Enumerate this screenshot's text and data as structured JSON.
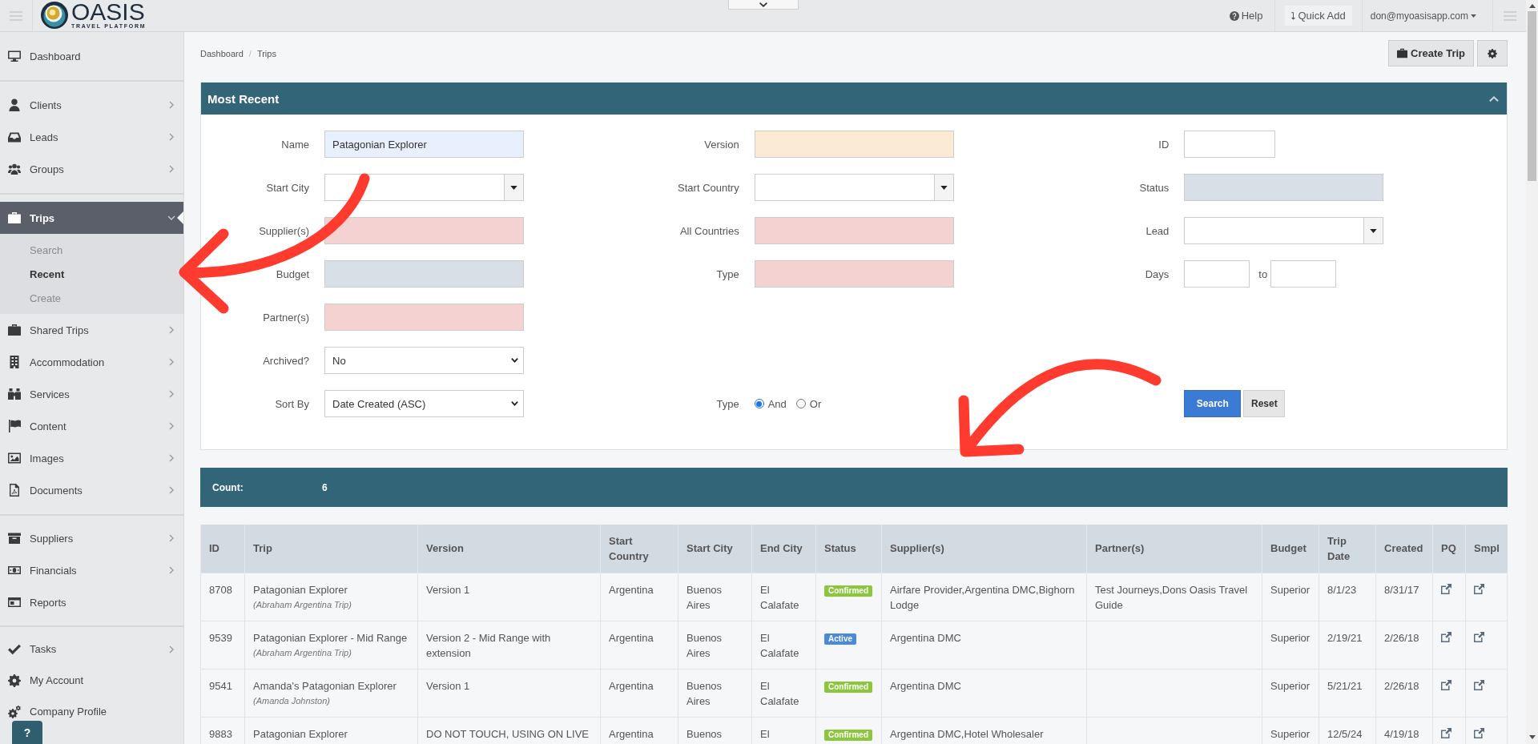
{
  "top_bar": {
    "logo": {
      "name": "OASIS",
      "tagline": "TRAVEL PLATFORM"
    },
    "help": "Help",
    "quick_add": "Quick Add",
    "user": "don@myoasisapp.com"
  },
  "sidebar": {
    "sections": [
      {
        "items": [
          {
            "label": "Dashboard",
            "expandable": false,
            "expanded": false,
            "selected": false
          }
        ]
      },
      {
        "items": [
          {
            "label": "Clients",
            "expandable": true,
            "expanded": false,
            "selected": false
          },
          {
            "label": "Leads",
            "expandable": true,
            "expanded": false,
            "selected": false
          },
          {
            "label": "Groups",
            "expandable": true,
            "expanded": false,
            "selected": false
          }
        ]
      },
      {
        "items": [
          {
            "label": "Trips",
            "expandable": true,
            "expanded": true,
            "selected": true,
            "children": [
              {
                "label": "Search",
                "selected": false
              },
              {
                "label": "Recent",
                "selected": true
              },
              {
                "label": "Create",
                "selected": false
              }
            ]
          },
          {
            "label": "Shared Trips",
            "expandable": true,
            "expanded": false,
            "selected": false
          },
          {
            "label": "Accommodation",
            "expandable": true,
            "expanded": false,
            "selected": false
          },
          {
            "label": "Services",
            "expandable": true,
            "expanded": false,
            "selected": false
          },
          {
            "label": "Content",
            "expandable": true,
            "expanded": false,
            "selected": false
          },
          {
            "label": "Images",
            "expandable": true,
            "expanded": false,
            "selected": false
          },
          {
            "label": "Documents",
            "expandable": true,
            "expanded": false,
            "selected": false
          }
        ]
      },
      {
        "items": [
          {
            "label": "Suppliers",
            "expandable": true,
            "expanded": false,
            "selected": false
          },
          {
            "label": "Financials",
            "expandable": true,
            "expanded": false,
            "selected": false
          },
          {
            "label": "Reports",
            "expandable": false,
            "expanded": false,
            "selected": false
          }
        ]
      },
      {
        "items": [
          {
            "label": "Tasks",
            "expandable": true,
            "expanded": false,
            "selected": false
          },
          {
            "label": "My Account",
            "expandable": false,
            "expanded": false,
            "selected": false
          },
          {
            "label": "Company Profile",
            "expandable": false,
            "expanded": false,
            "selected": false
          }
        ]
      }
    ]
  },
  "help_button": "?",
  "breadcrumb": {
    "items": [
      "Dashboard",
      "Trips"
    ],
    "separator": "/"
  },
  "create_button": "Create Trip",
  "search_panel": {
    "title": "Most Recent",
    "expanded": true,
    "rows": [
      {
        "cells": [
          {
            "kind": "text",
            "label": "Name",
            "value": "Patagonian Explorer",
            "color": "#e8f0fe"
          },
          {
            "kind": "text",
            "label": "Version",
            "color": "#fbebd5"
          },
          {
            "kind": "number",
            "label": "ID",
            "color": "#ffffff"
          }
        ]
      },
      {
        "cells": [
          {
            "kind": "combo",
            "label": "Start City",
            "color": "#ffffff"
          },
          {
            "kind": "combo",
            "label": "Start Country",
            "color": "#ffffff"
          },
          {
            "kind": "text",
            "label": "Status",
            "color": "#d8dfe7"
          }
        ]
      },
      {
        "cells": [
          {
            "kind": "text",
            "label": "Supplier(s)",
            "color": "#f5d2d2"
          },
          {
            "kind": "text",
            "label": "All Countries",
            "color": "#f5d2d2"
          },
          {
            "kind": "combo",
            "label": "Lead",
            "color": "#ffffff"
          }
        ]
      },
      {
        "cells": [
          {
            "kind": "text",
            "label": "Budget",
            "color": "#d8dfe7"
          },
          {
            "kind": "text",
            "label": "Type",
            "color": "#f5d2d2"
          },
          {
            "kind": "range",
            "label": "Days",
            "joiner": "to"
          }
        ]
      },
      {
        "cells": [
          {
            "kind": "text",
            "label": "Partner(s)",
            "color": "#f5d2d2"
          }
        ]
      },
      {
        "cells": [
          {
            "kind": "select",
            "label": "Archived?",
            "value": "No"
          }
        ]
      },
      {
        "cells": [
          {
            "kind": "select",
            "label": "Sort By",
            "value": "Date Created (ASC)"
          },
          {
            "kind": "radio",
            "label": "Type",
            "options": [
              {
                "label": "And",
                "selected": true
              },
              {
                "label": "Or",
                "selected": false
              }
            ]
          },
          {
            "kind": "buttons",
            "buttons": [
              {
                "label": "Search",
                "kind": "primary"
              },
              {
                "label": "Reset",
                "kind": "secondary"
              }
            ]
          }
        ]
      }
    ]
  },
  "count_bar": {
    "label": "Count:",
    "value": "6"
  },
  "table": {
    "columns": [
      "ID",
      "Trip",
      "Version",
      "Start Country",
      "Start City",
      "End City",
      "Status",
      "Supplier(s)",
      "Partner(s)",
      "Budget",
      "Trip Date",
      "Created",
      "PQ",
      "Smpl"
    ],
    "rows": [
      {
        "id": "8708",
        "trip": "Patagonian Explorer",
        "client": "(Abraham Argentina Trip)",
        "version": "Version 1",
        "start_country": "Argentina",
        "start_city": "Buenos Aires",
        "end_city": "El Calafate",
        "status": {
          "label": "Confirmed",
          "color": "#8cc63e"
        },
        "suppliers": "Airfare Provider,Argentina DMC,Bighorn Lodge",
        "partners": "Test Journeys,Dons Oasis Travel Guide",
        "budget": "Superior",
        "trip_date": "8/1/23",
        "created": "8/31/17"
      },
      {
        "id": "9539",
        "trip": "Patagonian Explorer - Mid Range",
        "client": "(Abraham Argentina Trip)",
        "version": "Version 2 - Mid Range with extension",
        "start_country": "Argentina",
        "start_city": "Buenos Aires",
        "end_city": "El Calafate",
        "status": {
          "label": "Active",
          "color": "#4a89dc"
        },
        "suppliers": "Argentina DMC",
        "budget": "Superior",
        "trip_date": "2/19/21",
        "created": "2/26/18"
      },
      {
        "id": "9541",
        "trip": "Amanda's Patagonian Explorer",
        "client": "(Amanda Johnston)",
        "version": "Version 1",
        "start_country": "Argentina",
        "start_city": "Buenos Aires",
        "end_city": "El Calafate",
        "status": {
          "label": "Confirmed",
          "color": "#8cc63e"
        },
        "suppliers": "Argentina DMC",
        "budget": "Superior",
        "trip_date": "5/21/21",
        "created": "2/26/18"
      },
      {
        "id": "9883",
        "trip": "Patagonian Explorer",
        "version": "DO NOT TOUCH, USING ON LIVE",
        "start_country": "Argentina",
        "start_city": "Buenos",
        "end_city": "El",
        "status": {
          "label": "Confirmed",
          "color": "#8cc63e"
        },
        "suppliers": "Argentina DMC,Hotel Wholesaler",
        "budget": "Superior",
        "trip_date": "12/5/24",
        "created": "4/19/18"
      }
    ]
  }
}
